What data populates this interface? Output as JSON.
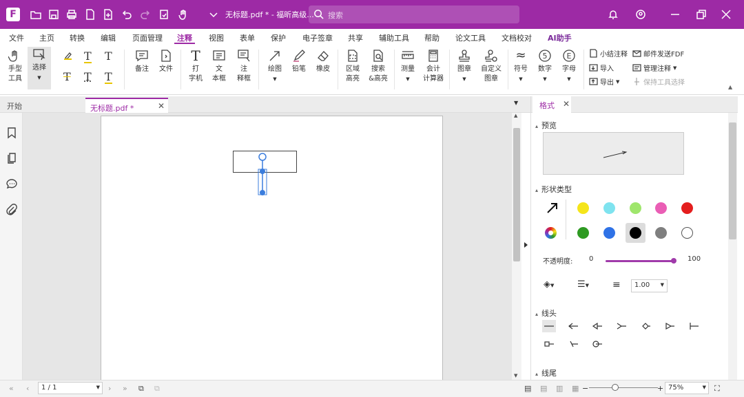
{
  "titlebar": {
    "doc_title": "无标题.pdf * - 福昕高级...",
    "search_placeholder": "搜索",
    "logo_letter": "F",
    "accent": "#9d2aa5"
  },
  "menubar": {
    "items": [
      "文件",
      "主页",
      "转换",
      "编辑",
      "页面管理",
      "注释",
      "视图",
      "表单",
      "保护",
      "电子签章",
      "共享",
      "辅助工具",
      "帮助",
      "论文工具",
      "文档校对",
      "AI助手"
    ],
    "active": "注释"
  },
  "ribbon": {
    "hand_tool": "手型\n工具",
    "select": "选择",
    "note": "备注",
    "file": "文件",
    "typewriter": "打\n字机",
    "textbox": "文\n本框",
    "callout": "注\n释框",
    "drawing": "绘图",
    "pencil": "铅笔",
    "eraser": "橡皮",
    "area_highlight": "区域\n高亮",
    "search_highlight": "搜索\n&高亮",
    "measure": "测量",
    "calc": "会计\n计算器",
    "stamp": "图章",
    "custom_stamp": "自定义\n图章",
    "symbol": "符号",
    "number": "数字",
    "letter": "字母",
    "summarize": "小结注释",
    "import": "导入",
    "export": "导出",
    "email_fdf": "邮件发送FDF",
    "manage": "管理注释",
    "keep_tool": "保持工具选择"
  },
  "tabs": {
    "start": "开始",
    "doc": "无标题.pdf *"
  },
  "panel": {
    "tab": "格式",
    "preview": "预览",
    "shape_type": "形状类型",
    "opacity_label": "不透明度:",
    "opacity_min": "0",
    "opacity_max": "100",
    "opacity_value": 100,
    "width_value": "1.00",
    "line_head": "线头",
    "line_tail": "线尾",
    "colors": [
      "#f5e51a",
      "#7fe3ef",
      "#9fe66c",
      "#ea5eb5",
      "#e41e1e",
      "#2e9a22",
      "#2f72e6",
      "#000000",
      "#7f7f7f",
      "#ffffff"
    ],
    "selected_color": "#000000"
  },
  "statusbar": {
    "page": "1 / 1",
    "zoom": "75%"
  }
}
